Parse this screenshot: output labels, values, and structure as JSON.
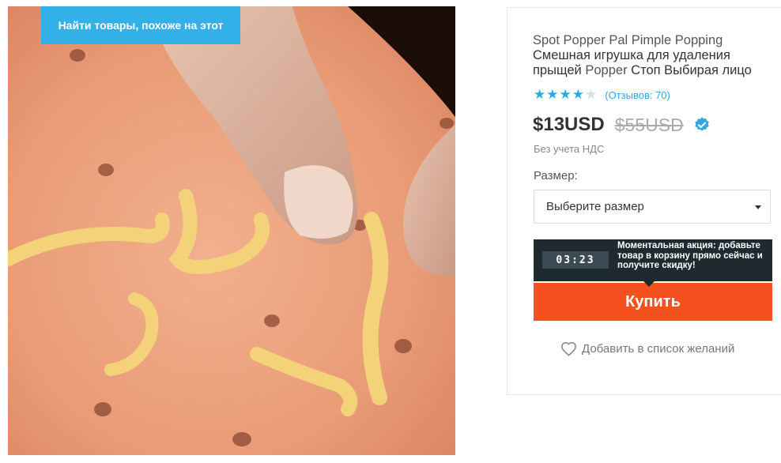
{
  "image": {
    "find_similar_label": "Найти товары, похоже на этот"
  },
  "product": {
    "title_en": "Spot Popper Pal Pimple Popping",
    "title_ru_1": "Смешная игрушка для удаления",
    "title_ru_2": "прыщей",
    "title_en_2": "Popper",
    "title_ru_3": "Стоп Выбирая лицо",
    "rating": 4,
    "rating_max": 5,
    "reviews_label": "(Отзывов: 70)",
    "price": "$13USD",
    "old_price": "$55USD",
    "vat_note": "Без учета НДС",
    "verified_icon": "verified-check-icon"
  },
  "size": {
    "label": "Размер:",
    "placeholder": "Выберите размер"
  },
  "promo": {
    "timer": "03:23",
    "text": "Моментальная акция: добавьте товар в корзину прямо сейчас и получите скидку!"
  },
  "actions": {
    "buy_label": "Купить",
    "wishlist_label": "Добавить в список желаний",
    "wishlist_icon": "heart-outline-icon"
  },
  "colors": {
    "accent_blue": "#30a9dd",
    "buy_orange": "#f4511e",
    "promo_dark": "#1e2a30",
    "find_button": "#33b0e8"
  }
}
